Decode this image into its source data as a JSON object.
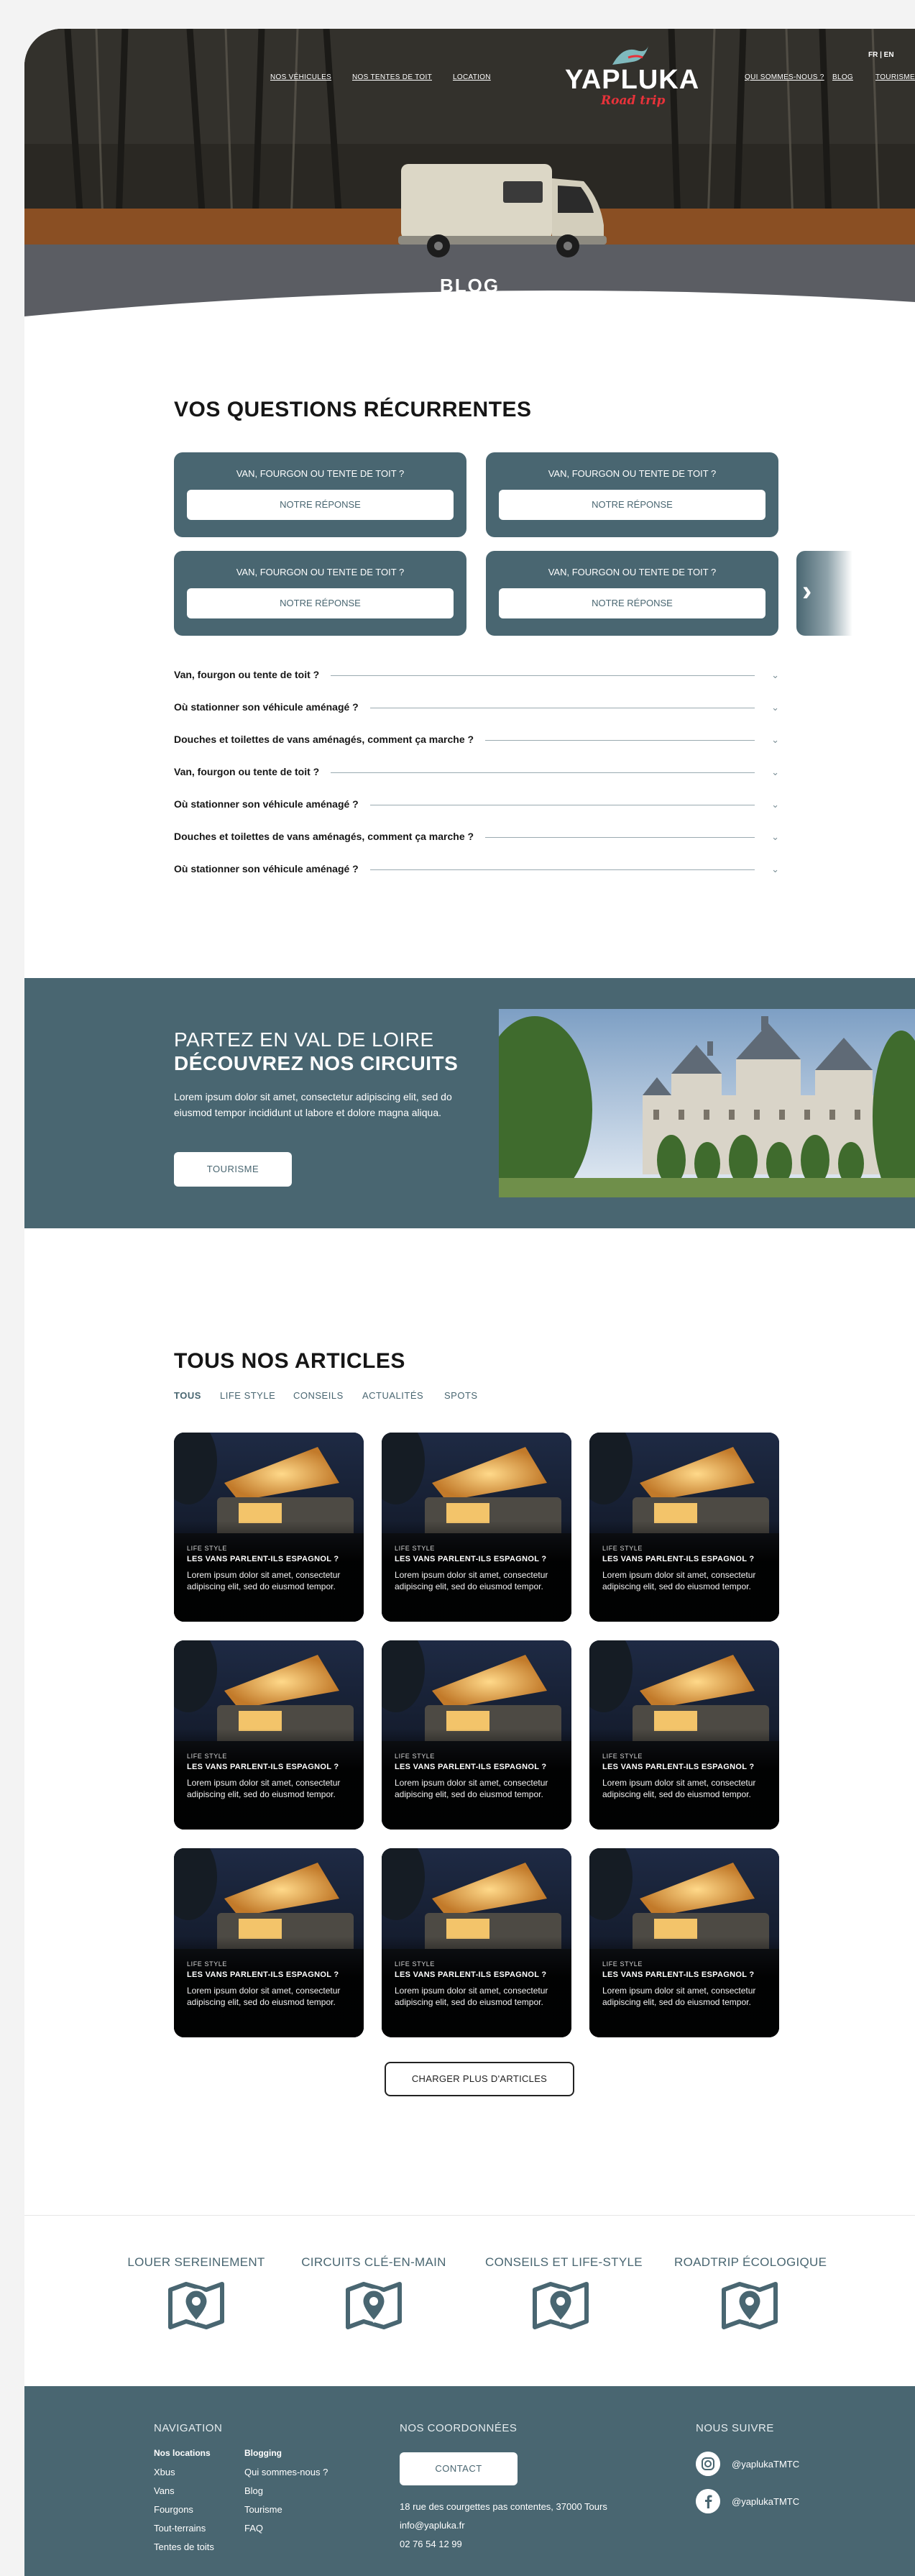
{
  "nav": {
    "left": [
      "NOS VÉHICULES",
      "NOS TENTES DE TOIT",
      "LOCATION"
    ],
    "right": [
      "QUI SOMMES-NOUS ?",
      "BLOG",
      "TOURISME"
    ],
    "lang": "FR | EN"
  },
  "logo": {
    "brand": "YAPLUKA",
    "tagline": "Road trip"
  },
  "hero": {
    "title": "BLOG"
  },
  "faq": {
    "title": "VOS QUESTIONS RÉCURRENTES",
    "cards": [
      {
        "question": "VAN, FOURGON OU TENTE DE TOIT ?",
        "answer_label": "NOTRE RÉPONSE"
      },
      {
        "question": "VAN, FOURGON OU TENTE DE TOIT ?",
        "answer_label": "NOTRE RÉPONSE"
      },
      {
        "question": "VAN, FOURGON OU TENTE DE TOIT ?",
        "answer_label": "NOTRE RÉPONSE"
      },
      {
        "question": "VAN, FOURGON OU TENTE DE TOIT ?",
        "answer_label": "NOTRE RÉPONSE"
      }
    ],
    "next_icon": "chevron-right-icon",
    "accordion": [
      "Van, fourgon ou tente de toit ?",
      "Où stationner son véhicule aménagé ?",
      "Douches et toilettes de vans aménagés, comment ça marche ?",
      "Van, fourgon ou tente de toit ?",
      "Où stationner son véhicule aménagé ?",
      "Douches et toilettes de vans aménagés, comment ça marche ?",
      "Où stationner son véhicule aménagé ?"
    ]
  },
  "promo": {
    "kicker": "PARTEZ EN VAL DE LOIRE",
    "headline": "DÉCOUVREZ NOS CIRCUITS",
    "text": "Lorem ipsum dolor sit amet, consectetur adipiscing elit, sed do eiusmod tempor incididunt ut labore et dolore magna aliqua.",
    "button": "TOURISME"
  },
  "articles": {
    "title": "TOUS NOS ARTICLES",
    "tabs": [
      "TOUS",
      "LIFE STYLE",
      "CONSEILS",
      "ACTUALITÉS",
      "SPOTS"
    ],
    "active_tab": "TOUS",
    "items": [
      {
        "category": "LIFE STYLE",
        "title": "LES VANS PARLENT-ILS ESPAGNOL ?",
        "excerpt": "Lorem ipsum dolor sit amet, consectetur adipiscing elit, sed do eiusmod tempor."
      },
      {
        "category": "LIFE STYLE",
        "title": "LES VANS PARLENT-ILS ESPAGNOL ?",
        "excerpt": "Lorem ipsum dolor sit amet, consectetur adipiscing elit, sed do eiusmod tempor."
      },
      {
        "category": "LIFE STYLE",
        "title": "LES VANS PARLENT-ILS ESPAGNOL ?",
        "excerpt": "Lorem ipsum dolor sit amet, consectetur adipiscing elit, sed do eiusmod tempor."
      },
      {
        "category": "LIFE STYLE",
        "title": "LES VANS PARLENT-ILS ESPAGNOL ?",
        "excerpt": "Lorem ipsum dolor sit amet, consectetur adipiscing elit, sed do eiusmod tempor."
      },
      {
        "category": "LIFE STYLE",
        "title": "LES VANS PARLENT-ILS ESPAGNOL ?",
        "excerpt": "Lorem ipsum dolor sit amet, consectetur adipiscing elit, sed do eiusmod tempor."
      },
      {
        "category": "LIFE STYLE",
        "title": "LES VANS PARLENT-ILS ESPAGNOL ?",
        "excerpt": "Lorem ipsum dolor sit amet, consectetur adipiscing elit, sed do eiusmod tempor."
      },
      {
        "category": "LIFE STYLE",
        "title": "LES VANS PARLENT-ILS ESPAGNOL ?",
        "excerpt": "Lorem ipsum dolor sit amet, consectetur adipiscing elit, sed do eiusmod tempor."
      },
      {
        "category": "LIFE STYLE",
        "title": "LES VANS PARLENT-ILS ESPAGNOL ?",
        "excerpt": "Lorem ipsum dolor sit amet, consectetur adipiscing elit, sed do eiusmod tempor."
      },
      {
        "category": "LIFE STYLE",
        "title": "LES VANS PARLENT-ILS ESPAGNOL ?",
        "excerpt": "Lorem ipsum dolor sit amet, consectetur adipiscing elit, sed do eiusmod tempor."
      }
    ],
    "load_more": "CHARGER PLUS D'ARTICLES"
  },
  "features": [
    {
      "label": "LOUER SEREINEMENT",
      "icon": "map-pin-icon"
    },
    {
      "label": "CIRCUITS CLÉ-EN-MAIN",
      "icon": "map-pin-icon"
    },
    {
      "label": "CONSEILS ET LIFE-STYLE",
      "icon": "map-pin-icon"
    },
    {
      "label": "ROADTRIP ÉCOLOGIQUE",
      "icon": "map-pin-icon"
    }
  ],
  "footer": {
    "navigation": {
      "heading": "NAVIGATION",
      "col1_title": "Nos locations",
      "col1": [
        "Xbus",
        "Vans",
        "Fourgons",
        "Tout-terrains",
        "Tentes de toits"
      ],
      "col2_title": "Blogging",
      "col2": [
        "Qui sommes-nous ?",
        "Blog",
        "Tourisme",
        "FAQ"
      ]
    },
    "contact": {
      "heading": "NOS COORDONNÉES",
      "button": "CONTACT",
      "address": "18 rue des courgettes pas contentes, 37000 Tours",
      "email": "info@yapluka.fr",
      "phone": "02 76 54 12 99"
    },
    "social": {
      "heading": "NOUS SUIVRE",
      "instagram": "@yaplukaTMTC",
      "facebook": "@yaplukaTMTC"
    }
  },
  "colors": {
    "primary": "#496671",
    "accent_red": "#e8323a",
    "text_dark": "#161616"
  }
}
